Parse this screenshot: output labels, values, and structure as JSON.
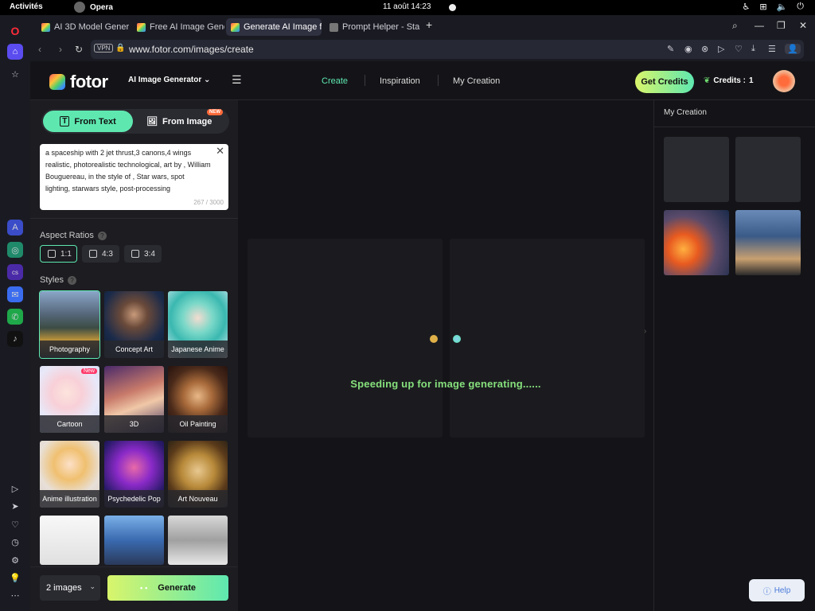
{
  "system_bar": {
    "activities": "Activités",
    "app": "Opera",
    "clock": "11 août  14:23"
  },
  "browser": {
    "tabs": [
      {
        "title": "AI 3D Model Gener",
        "active": false
      },
      {
        "title": "Free AI Image Gene",
        "active": false
      },
      {
        "title": "Generate AI Image f",
        "active": true
      },
      {
        "title": "Prompt Helper - Sta",
        "active": false
      }
    ],
    "url": "www.fotor.com/images/create",
    "vpn_label": "VPN"
  },
  "header": {
    "logo_text": "fotor",
    "tool_menu": "AI Image Generator",
    "nav": [
      {
        "label": "Create",
        "active": true
      },
      {
        "label": "Inspiration",
        "active": false
      },
      {
        "label": "My Creation",
        "active": false
      }
    ],
    "get_credits": "Get Credits",
    "credits_label": "Credits :",
    "credits_value": "1"
  },
  "left_panel": {
    "mode_from_text": "From Text",
    "mode_from_image": "From Image",
    "new_badge": "NEW",
    "prompt_text": "a spaceship with 2 jet thrust,3 canons,4 wings realistic,  photorealistic technological, art by , William Bouguereau, in the style of ,  Star wars,  spot lighting, starwars style,  post-processing",
    "char_count": "267 / 3000",
    "aspect_label": "Aspect Ratios",
    "ratios": [
      "1:1",
      "4:3",
      "3:4"
    ],
    "styles_label": "Styles",
    "styles": [
      {
        "name": "Photography",
        "active": true
      },
      {
        "name": "Concept Art",
        "active": false
      },
      {
        "name": "Japanese Anime",
        "active": false
      },
      {
        "name": "Cartoon",
        "active": false,
        "badge": "New"
      },
      {
        "name": "3D",
        "active": false
      },
      {
        "name": "Oil Painting",
        "active": false
      },
      {
        "name": "Anime illustration",
        "active": false
      },
      {
        "name": "Psychedelic Pop",
        "active": false
      },
      {
        "name": "Art Nouveau",
        "active": false
      }
    ],
    "image_count": "2 images",
    "generate": "Generate"
  },
  "center": {
    "loading_text": "Speeding up for image generating......"
  },
  "right_panel": {
    "title": "My Creation",
    "help": "Help"
  },
  "colors": {
    "accent": "#5ee8b0",
    "loading_text": "#86e07c",
    "background": "#141418"
  }
}
